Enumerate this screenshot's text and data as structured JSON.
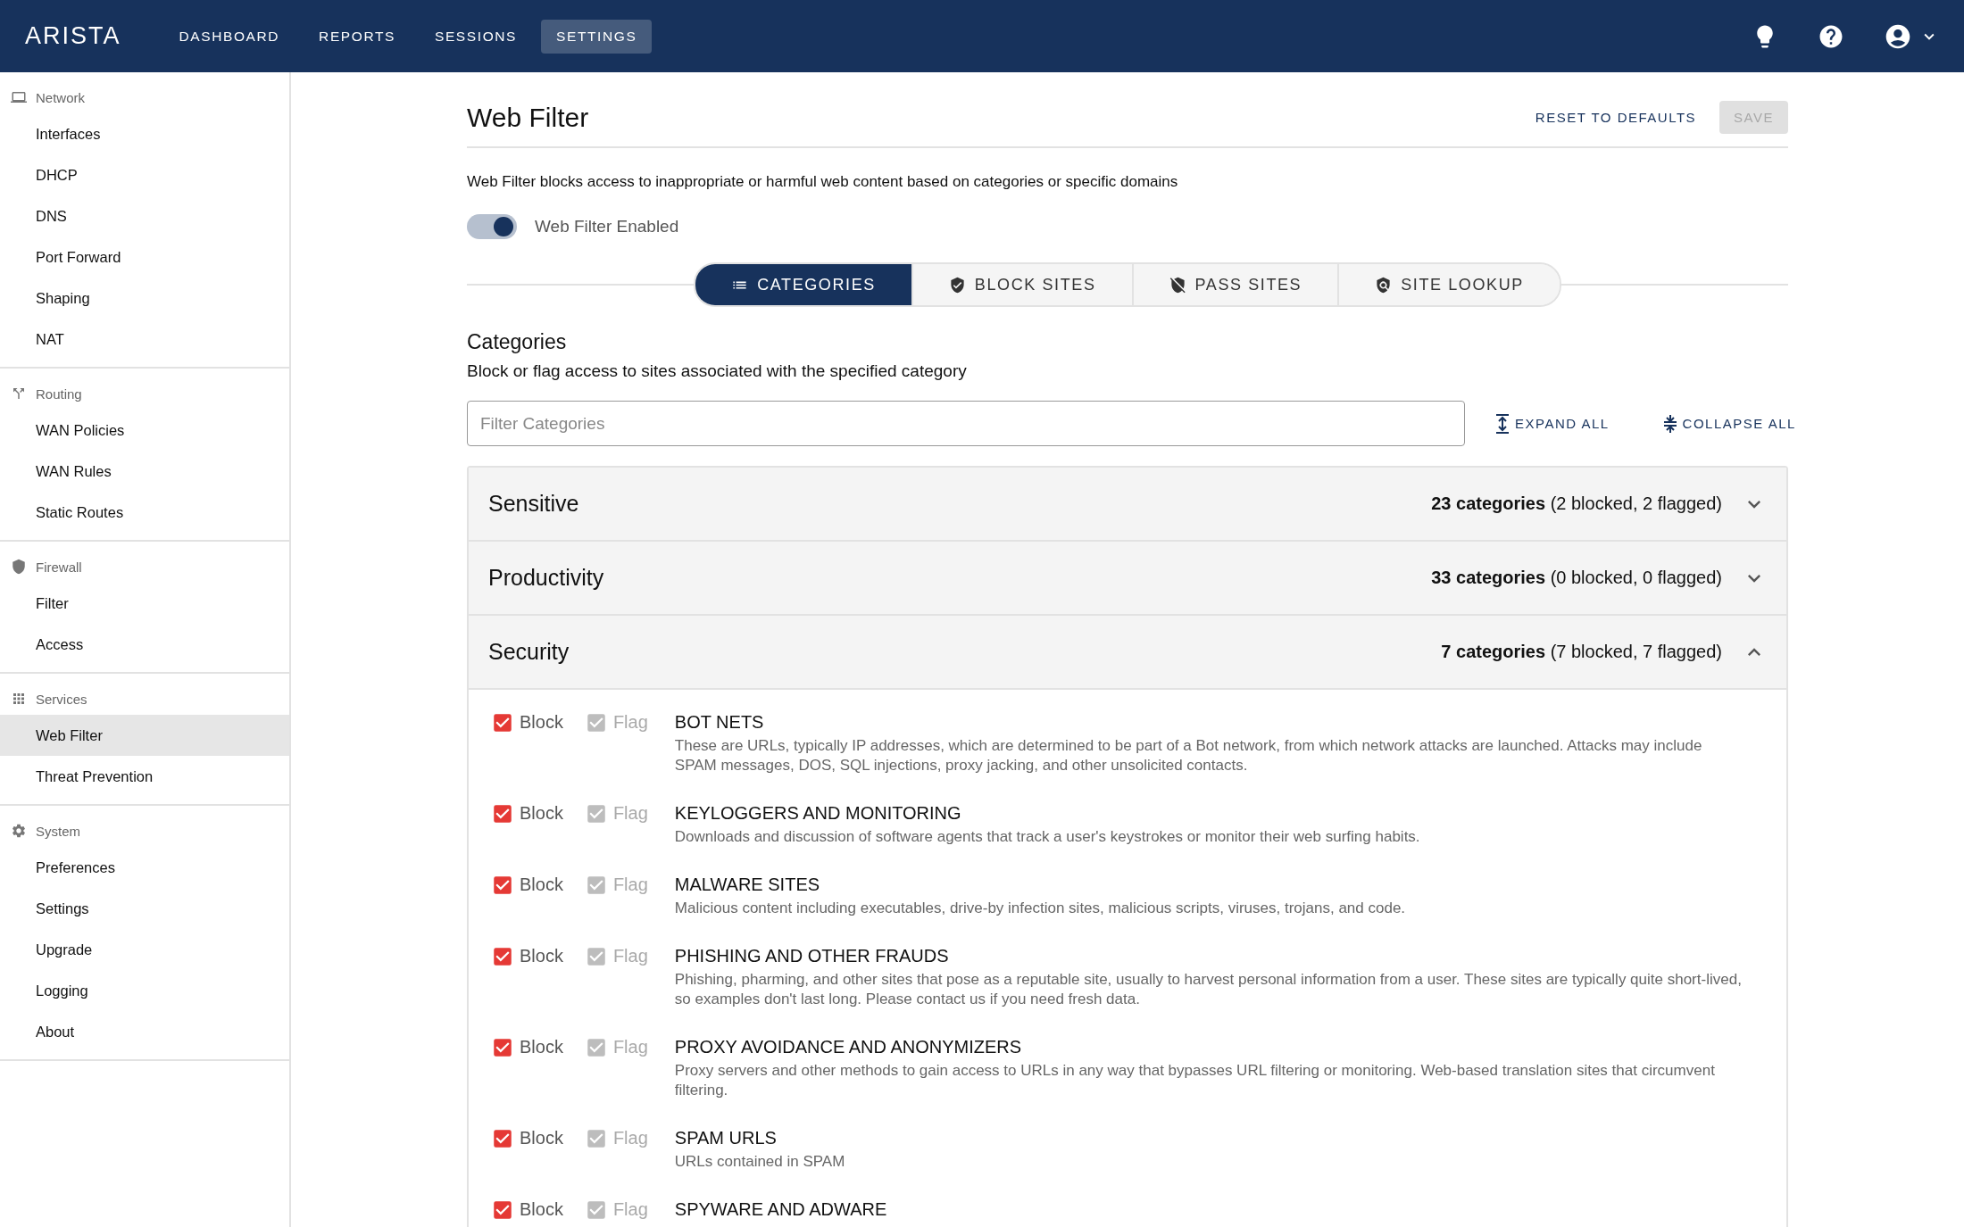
{
  "top_bar": {
    "logo": "ARISTA",
    "nav": [
      {
        "label": "DASHBOARD",
        "selected": false
      },
      {
        "label": "REPORTS",
        "selected": false
      },
      {
        "label": "SESSIONS",
        "selected": false
      },
      {
        "label": "SETTINGS",
        "selected": true
      }
    ]
  },
  "sidebar": {
    "sections": [
      {
        "title": "Network",
        "items": [
          {
            "label": "Interfaces",
            "selected": false
          },
          {
            "label": "DHCP",
            "selected": false
          },
          {
            "label": "DNS",
            "selected": false
          },
          {
            "label": "Port Forward",
            "selected": false
          },
          {
            "label": "Shaping",
            "selected": false
          },
          {
            "label": "NAT",
            "selected": false
          }
        ]
      },
      {
        "title": "Routing",
        "items": [
          {
            "label": "WAN Policies",
            "selected": false
          },
          {
            "label": "WAN Rules",
            "selected": false
          },
          {
            "label": "Static Routes",
            "selected": false
          }
        ]
      },
      {
        "title": "Firewall",
        "items": [
          {
            "label": "Filter",
            "selected": false
          },
          {
            "label": "Access",
            "selected": false
          }
        ]
      },
      {
        "title": "Services",
        "items": [
          {
            "label": "Web Filter",
            "selected": true
          },
          {
            "label": "Threat Prevention",
            "selected": false
          }
        ]
      },
      {
        "title": "System",
        "items": [
          {
            "label": "Preferences",
            "selected": false
          },
          {
            "label": "Settings",
            "selected": false
          },
          {
            "label": "Upgrade",
            "selected": false
          },
          {
            "label": "Logging",
            "selected": false
          },
          {
            "label": "About",
            "selected": false
          }
        ]
      }
    ]
  },
  "page": {
    "title": "Web Filter",
    "reset_button": "RESET TO DEFAULTS",
    "save_button": {
      "label": "SAVE",
      "disabled": true
    },
    "description": "Web Filter blocks access to inappropriate or harmful web content based on categories or specific domains",
    "toggle": {
      "label": "Web Filter Enabled",
      "on": true
    },
    "tabs": [
      {
        "label": "CATEGORIES",
        "selected": true
      },
      {
        "label": "BLOCK SITES",
        "selected": false
      },
      {
        "label": "PASS SITES",
        "selected": false
      },
      {
        "label": "SITE LOOKUP",
        "selected": false
      }
    ],
    "categories": {
      "heading": "Categories",
      "subtitle": "Block or flag access to sites associated with the specified category",
      "filter": {
        "placeholder": "Filter Categories"
      },
      "expand_all": "EXPAND ALL",
      "collapse_all": "COLLAPSE ALL",
      "groups": [
        {
          "name": "Sensitive",
          "count": "23 categories",
          "detail": "(2 blocked, 2 flagged)",
          "expanded": false
        },
        {
          "name": "Productivity",
          "count": "33 categories",
          "detail": "(0 blocked, 0 flagged)",
          "expanded": false
        },
        {
          "name": "Security",
          "count": "7 categories",
          "detail": "(7 blocked, 7 flagged)",
          "expanded": true,
          "items": [
            {
              "block_label": "Block",
              "blocked": true,
              "flag_label": "Flag",
              "flagged": true,
              "title": "BOT NETS",
              "description": "These are URLs, typically IP addresses, which are determined to be part of a Bot network, from which network attacks are launched. Attacks may include SPAM messages, DOS, SQL injections, proxy jacking, and other unsolicited contacts."
            },
            {
              "block_label": "Block",
              "blocked": true,
              "flag_label": "Flag",
              "flagged": true,
              "title": "KEYLOGGERS AND MONITORING",
              "description": "Downloads and discussion of software agents that track a user's keystrokes or monitor their web surfing habits."
            },
            {
              "block_label": "Block",
              "blocked": true,
              "flag_label": "Flag",
              "flagged": true,
              "title": "MALWARE SITES",
              "description": "Malicious content including executables, drive-by infection sites, malicious scripts, viruses, trojans, and code."
            },
            {
              "block_label": "Block",
              "blocked": true,
              "flag_label": "Flag",
              "flagged": true,
              "title": "PHISHING AND OTHER FRAUDS",
              "description": "Phishing, pharming, and other sites that pose as a reputable site, usually to harvest personal information from a user. These sites are typically quite short-lived, so examples don't last long. Please contact us if you need fresh data."
            },
            {
              "block_label": "Block",
              "blocked": true,
              "flag_label": "Flag",
              "flagged": true,
              "title": "PROXY AVOIDANCE AND ANONYMIZERS",
              "description": "Proxy servers and other methods to gain access to URLs in any way that bypasses URL filtering or monitoring. Web-based translation sites that circumvent filtering."
            },
            {
              "block_label": "Block",
              "blocked": true,
              "flag_label": "Flag",
              "flagged": true,
              "title": "SPAM URLS",
              "description": "URLs contained in SPAM"
            },
            {
              "block_label": "Block",
              "blocked": true,
              "flag_label": "Flag",
              "flagged": true,
              "title": "SPYWARE AND ADWARE"
            }
          ]
        }
      ]
    }
  }
}
